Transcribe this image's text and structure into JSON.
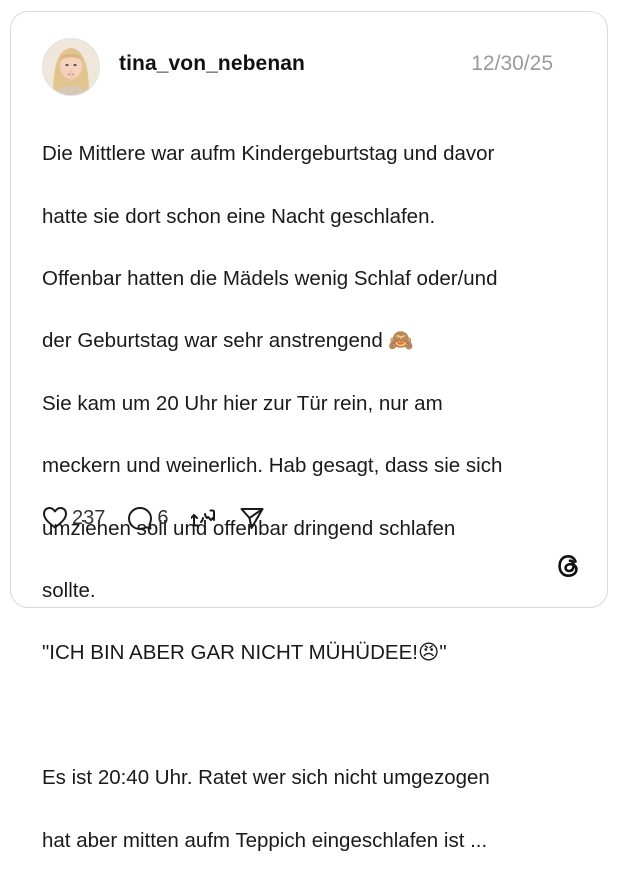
{
  "post": {
    "username": "tina_von_nebenan",
    "date": "12/30/25",
    "text_lines": [
      "Die Mittlere war aufm Kindergeburtstag und davor",
      "hatte sie dort schon eine Nacht geschlafen.",
      "Offenbar hatten die Mädels wenig Schlaf oder/und",
      "der Geburtstag war sehr anstrengend 🙈",
      "Sie kam um 20 Uhr hier zur Tür rein, nur am",
      "meckern und weinerlich. Hab gesagt, dass sie sich",
      "umziehen soll und offenbar dringend schlafen",
      "sollte.",
      "\"ICH BIN ABER GAR NICHT MÜHÜDEE!😠\"",
      "",
      "Es ist 20:40 Uhr. Ratet wer sich nicht umgezogen",
      "hat aber mitten aufm Teppich eingeschlafen ist ..."
    ]
  },
  "actions": {
    "likes": "237",
    "replies": "6",
    "like_icon": "heart-icon",
    "reply_icon": "comment-bubble-icon",
    "repost_icon": "repost-icon",
    "share_icon": "send-icon"
  },
  "brand": {
    "logo": "threads-logo-icon"
  }
}
